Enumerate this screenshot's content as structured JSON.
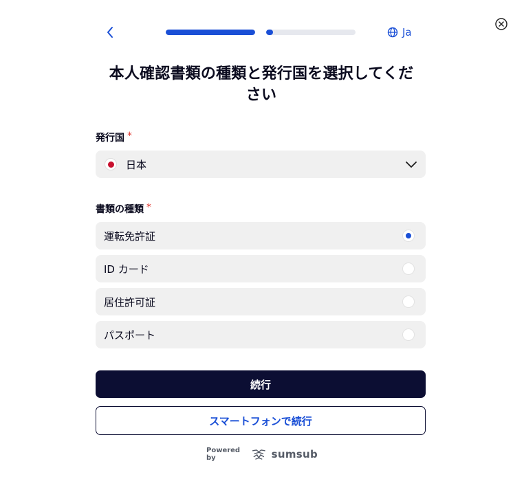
{
  "header": {
    "back_icon": "chevron-left-icon",
    "progress": [
      {
        "fill": 1.0
      },
      {
        "fill": 0.08
      }
    ],
    "language_label": "Ja",
    "language_icon": "globe-icon",
    "close_icon": "close-circle-icon"
  },
  "colors": {
    "accent": "#1a4fd6",
    "primary_button": "#0c0e33",
    "field_background": "#f0f0f0",
    "required": "#e0362f"
  },
  "title": {
    "line1": "本人確認書類の種類と発行国を選択してくだ",
    "line2": "さい"
  },
  "country": {
    "label": "発行国",
    "required_mark": "*",
    "selected": "日本",
    "flag_icon": "japan-flag-icon",
    "dropdown_icon": "chevron-down-icon"
  },
  "document_type": {
    "label": "書類の種類",
    "required_mark": "*",
    "options": [
      {
        "label": "運転免許証",
        "selected": true
      },
      {
        "label": "ID カード",
        "selected": false
      },
      {
        "label": "居住許可証",
        "selected": false
      },
      {
        "label": "パスポート",
        "selected": false
      }
    ]
  },
  "actions": {
    "continue_label": "続行",
    "smartphone_label": "スマートフォンで続行"
  },
  "footer": {
    "powered_by": "Powered by",
    "brand": "sumsub",
    "brand_icon": "sumsub-logo-icon"
  }
}
